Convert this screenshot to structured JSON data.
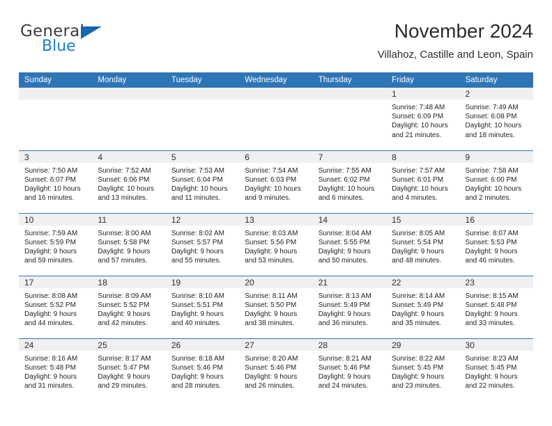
{
  "brand": {
    "name_top": "General",
    "name_bottom": "Blue",
    "accent_color": "#1d7fc4",
    "triangle_color": "#1667ad",
    "triangle_icon": "triangle-icon"
  },
  "header": {
    "title": "November 2024",
    "subtitle": "Villahoz, Castille and Leon, Spain"
  },
  "calendar": {
    "header_bg": "#2e75b6",
    "daynum_bg": "#f0f0f0",
    "weekdays": [
      "Sunday",
      "Monday",
      "Tuesday",
      "Wednesday",
      "Thursday",
      "Friday",
      "Saturday"
    ],
    "weeks": [
      [
        {
          "day": "",
          "empty": true
        },
        {
          "day": "",
          "empty": true
        },
        {
          "day": "",
          "empty": true
        },
        {
          "day": "",
          "empty": true
        },
        {
          "day": "",
          "empty": true
        },
        {
          "day": "1",
          "sunrise": "Sunrise: 7:48 AM",
          "sunset": "Sunset: 6:09 PM",
          "daylight1": "Daylight: 10 hours",
          "daylight2": "and 21 minutes."
        },
        {
          "day": "2",
          "sunrise": "Sunrise: 7:49 AM",
          "sunset": "Sunset: 6:08 PM",
          "daylight1": "Daylight: 10 hours",
          "daylight2": "and 18 minutes."
        }
      ],
      [
        {
          "day": "3",
          "sunrise": "Sunrise: 7:50 AM",
          "sunset": "Sunset: 6:07 PM",
          "daylight1": "Daylight: 10 hours",
          "daylight2": "and 16 minutes."
        },
        {
          "day": "4",
          "sunrise": "Sunrise: 7:52 AM",
          "sunset": "Sunset: 6:06 PM",
          "daylight1": "Daylight: 10 hours",
          "daylight2": "and 13 minutes."
        },
        {
          "day": "5",
          "sunrise": "Sunrise: 7:53 AM",
          "sunset": "Sunset: 6:04 PM",
          "daylight1": "Daylight: 10 hours",
          "daylight2": "and 11 minutes."
        },
        {
          "day": "6",
          "sunrise": "Sunrise: 7:54 AM",
          "sunset": "Sunset: 6:03 PM",
          "daylight1": "Daylight: 10 hours",
          "daylight2": "and 9 minutes."
        },
        {
          "day": "7",
          "sunrise": "Sunrise: 7:55 AM",
          "sunset": "Sunset: 6:02 PM",
          "daylight1": "Daylight: 10 hours",
          "daylight2": "and 6 minutes."
        },
        {
          "day": "8",
          "sunrise": "Sunrise: 7:57 AM",
          "sunset": "Sunset: 6:01 PM",
          "daylight1": "Daylight: 10 hours",
          "daylight2": "and 4 minutes."
        },
        {
          "day": "9",
          "sunrise": "Sunrise: 7:58 AM",
          "sunset": "Sunset: 6:00 PM",
          "daylight1": "Daylight: 10 hours",
          "daylight2": "and 2 minutes."
        }
      ],
      [
        {
          "day": "10",
          "sunrise": "Sunrise: 7:59 AM",
          "sunset": "Sunset: 5:59 PM",
          "daylight1": "Daylight: 9 hours",
          "daylight2": "and 59 minutes."
        },
        {
          "day": "11",
          "sunrise": "Sunrise: 8:00 AM",
          "sunset": "Sunset: 5:58 PM",
          "daylight1": "Daylight: 9 hours",
          "daylight2": "and 57 minutes."
        },
        {
          "day": "12",
          "sunrise": "Sunrise: 8:02 AM",
          "sunset": "Sunset: 5:57 PM",
          "daylight1": "Daylight: 9 hours",
          "daylight2": "and 55 minutes."
        },
        {
          "day": "13",
          "sunrise": "Sunrise: 8:03 AM",
          "sunset": "Sunset: 5:56 PM",
          "daylight1": "Daylight: 9 hours",
          "daylight2": "and 53 minutes."
        },
        {
          "day": "14",
          "sunrise": "Sunrise: 8:04 AM",
          "sunset": "Sunset: 5:55 PM",
          "daylight1": "Daylight: 9 hours",
          "daylight2": "and 50 minutes."
        },
        {
          "day": "15",
          "sunrise": "Sunrise: 8:05 AM",
          "sunset": "Sunset: 5:54 PM",
          "daylight1": "Daylight: 9 hours",
          "daylight2": "and 48 minutes."
        },
        {
          "day": "16",
          "sunrise": "Sunrise: 8:07 AM",
          "sunset": "Sunset: 5:53 PM",
          "daylight1": "Daylight: 9 hours",
          "daylight2": "and 46 minutes."
        }
      ],
      [
        {
          "day": "17",
          "sunrise": "Sunrise: 8:08 AM",
          "sunset": "Sunset: 5:52 PM",
          "daylight1": "Daylight: 9 hours",
          "daylight2": "and 44 minutes."
        },
        {
          "day": "18",
          "sunrise": "Sunrise: 8:09 AM",
          "sunset": "Sunset: 5:52 PM",
          "daylight1": "Daylight: 9 hours",
          "daylight2": "and 42 minutes."
        },
        {
          "day": "19",
          "sunrise": "Sunrise: 8:10 AM",
          "sunset": "Sunset: 5:51 PM",
          "daylight1": "Daylight: 9 hours",
          "daylight2": "and 40 minutes."
        },
        {
          "day": "20",
          "sunrise": "Sunrise: 8:11 AM",
          "sunset": "Sunset: 5:50 PM",
          "daylight1": "Daylight: 9 hours",
          "daylight2": "and 38 minutes."
        },
        {
          "day": "21",
          "sunrise": "Sunrise: 8:13 AM",
          "sunset": "Sunset: 5:49 PM",
          "daylight1": "Daylight: 9 hours",
          "daylight2": "and 36 minutes."
        },
        {
          "day": "22",
          "sunrise": "Sunrise: 8:14 AM",
          "sunset": "Sunset: 5:49 PM",
          "daylight1": "Daylight: 9 hours",
          "daylight2": "and 35 minutes."
        },
        {
          "day": "23",
          "sunrise": "Sunrise: 8:15 AM",
          "sunset": "Sunset: 5:48 PM",
          "daylight1": "Daylight: 9 hours",
          "daylight2": "and 33 minutes."
        }
      ],
      [
        {
          "day": "24",
          "sunrise": "Sunrise: 8:16 AM",
          "sunset": "Sunset: 5:48 PM",
          "daylight1": "Daylight: 9 hours",
          "daylight2": "and 31 minutes."
        },
        {
          "day": "25",
          "sunrise": "Sunrise: 8:17 AM",
          "sunset": "Sunset: 5:47 PM",
          "daylight1": "Daylight: 9 hours",
          "daylight2": "and 29 minutes."
        },
        {
          "day": "26",
          "sunrise": "Sunrise: 8:18 AM",
          "sunset": "Sunset: 5:46 PM",
          "daylight1": "Daylight: 9 hours",
          "daylight2": "and 28 minutes."
        },
        {
          "day": "27",
          "sunrise": "Sunrise: 8:20 AM",
          "sunset": "Sunset: 5:46 PM",
          "daylight1": "Daylight: 9 hours",
          "daylight2": "and 26 minutes."
        },
        {
          "day": "28",
          "sunrise": "Sunrise: 8:21 AM",
          "sunset": "Sunset: 5:46 PM",
          "daylight1": "Daylight: 9 hours",
          "daylight2": "and 24 minutes."
        },
        {
          "day": "29",
          "sunrise": "Sunrise: 8:22 AM",
          "sunset": "Sunset: 5:45 PM",
          "daylight1": "Daylight: 9 hours",
          "daylight2": "and 23 minutes."
        },
        {
          "day": "30",
          "sunrise": "Sunrise: 8:23 AM",
          "sunset": "Sunset: 5:45 PM",
          "daylight1": "Daylight: 9 hours",
          "daylight2": "and 22 minutes."
        }
      ]
    ]
  }
}
